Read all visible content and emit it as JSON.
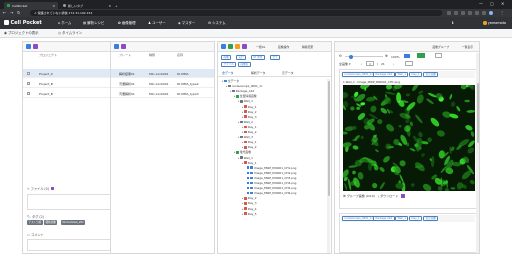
{
  "browser": {
    "tabs": [
      {
        "title": "CellPocket"
      },
      {
        "title": "新しいタブ"
      }
    ],
    "new_tab": "+",
    "url": "保護されていない通信  172.31.192.154",
    "window_controls": [
      "—",
      "▢",
      "✕"
    ]
  },
  "app": {
    "brand": "Cell Pocket",
    "nav": [
      "ホーム",
      "解析レシピ",
      "画像管理",
      "ユーザー",
      "マスター",
      "システム"
    ],
    "user": "yamamoto"
  },
  "subnav": {
    "project_view": "プロジェクトの表示",
    "timeline": "タイムライン"
  },
  "project_panel": {
    "col_project": "プロジェクト",
    "col_comment": "コ",
    "rows": [
      "Project_0",
      "Project_B",
      "Project_B"
    ],
    "file_label": "ファイル (0)",
    "tag_label": "タグ (2)",
    "tags": [
      "テスト分析",
      "細胞画像",
      "NucleoView_201"
    ],
    "comment_label": "コメント"
  },
  "plate_panel": {
    "col_plate": "プレート",
    "col_type": "種類",
    "col_name": "名称",
    "rows": [
      {
        "plate": "解析結果01",
        "type": "MiC-xxx0001",
        "name": "DI-MMA"
      },
      {
        "plate": "汚濁解析01",
        "type": "MiC-xxx0001",
        "name": "DI-MMA_type2"
      },
      {
        "plate": "汚濁解析01",
        "type": "MiC-xxx0001",
        "name": "DI-MMA_type3"
      }
    ]
  },
  "file_panel": {
    "head_buttons": [
      "一括DL",
      "画像操作",
      "解析結果"
    ],
    "filter_row1": [
      "画像",
      "実行",
      "ID 条件",
      "全て"
    ],
    "filter_row2": [
      "ファイル",
      "画像名"
    ],
    "tabs": [
      "全データ",
      "解析データ",
      "元データ"
    ],
    "tree": [
      {
        "label": "全データ",
        "depth": 0,
        "kind": "root"
      },
      {
        "label": "nucleoscope_0001_1c",
        "depth": 1,
        "kind": "folder"
      },
      {
        "label": "Package_A10",
        "depth": 2,
        "kind": "folder"
      },
      {
        "label": "位置情報画像",
        "depth": 3,
        "kind": "image"
      },
      {
        "label": "Well_1",
        "depth": 4,
        "kind": "folder"
      },
      {
        "label": "Day_1",
        "depth": 5,
        "kind": "day"
      },
      {
        "label": "Day_2",
        "depth": 5,
        "kind": "day"
      },
      {
        "label": "Day_3",
        "depth": 5,
        "kind": "day"
      },
      {
        "label": "Well_2",
        "depth": 4,
        "kind": "folder"
      },
      {
        "label": "Day_1",
        "depth": 5,
        "kind": "day"
      },
      {
        "label": "Day_2",
        "depth": 5,
        "kind": "day"
      },
      {
        "label": "Well_3",
        "depth": 4,
        "kind": "folder"
      },
      {
        "label": "Day_1",
        "depth": 5,
        "kind": "day"
      },
      {
        "label": "Day_2",
        "depth": 5,
        "kind": "day"
      },
      {
        "label": "蛍光画像",
        "depth": 3,
        "kind": "image"
      },
      {
        "label": "Well_1",
        "depth": 4,
        "kind": "folder"
      },
      {
        "label": "Day_1",
        "depth": 5,
        "kind": "day"
      },
      {
        "label": "Image_MWP_P00001_CH1.png",
        "depth": 6,
        "kind": "file"
      },
      {
        "label": "Image_MWP_P00001_CH2.png",
        "depth": 6,
        "kind": "file"
      },
      {
        "label": "Image_MWP_P00001_CH3.png",
        "depth": 6,
        "kind": "file"
      },
      {
        "label": "Image_MWP_P00001_CH4.png",
        "depth": 6,
        "kind": "file"
      },
      {
        "label": "Image_MWP_P00001_CH5.png",
        "depth": 6,
        "kind": "file"
      },
      {
        "label": "Image_MWP_P00001_CH6.png",
        "depth": 6,
        "kind": "file"
      },
      {
        "label": "Day_2",
        "depth": 5,
        "kind": "day"
      },
      {
        "label": "Day_3",
        "depth": 5,
        "kind": "day"
      },
      {
        "label": "Day_4",
        "depth": 5,
        "kind": "day"
      },
      {
        "label": "Day_5",
        "depth": 5,
        "kind": "day"
      }
    ]
  },
  "viewer_panel": {
    "head_buttons": [
      "画像グループ",
      "一覧表示"
    ],
    "zoom": "100%",
    "channel_label": "全画像",
    "page_current": "1",
    "page_sep": "/",
    "page_total": "21",
    "info_pills": [
      "nucleoscope_0001_1c",
      "Package A10",
      "Well_1",
      "Day_1",
      "蛍光画像"
    ],
    "image_caption": "1 Well_1 - Image_MWP_P00001_CH1.png",
    "footer_group": "グループ画像 (0/10)",
    "footer_download": "ダウンロード",
    "info_pills2": [
      "nucleoscope_0001_1c",
      "Package A10",
      "Well_1",
      "Day_1",
      "蛍光画像"
    ]
  },
  "colors": {
    "accent_blue": "#3b7ddd",
    "green": "#2e9f4e",
    "orange": "#f0a020",
    "purple": "#8a4bc8",
    "appbar": "#2f3338"
  }
}
